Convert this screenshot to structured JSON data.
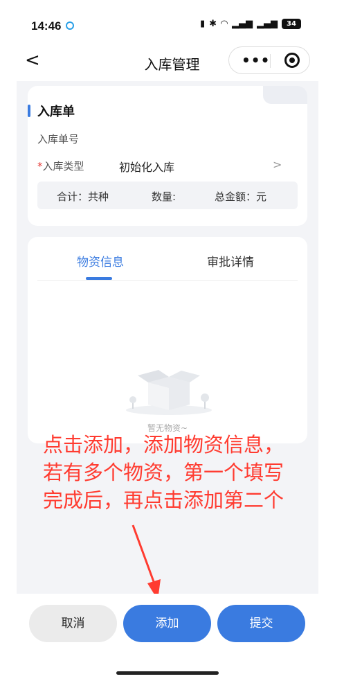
{
  "status_bar": {
    "time": "14:46",
    "battery": "34"
  },
  "nav": {
    "title": "入库管理"
  },
  "form": {
    "section_title": "入库单",
    "order_no_label": "入库单号",
    "type_required_mark": "*",
    "type_label": "入库类型",
    "type_value": "初始化入库",
    "chevron": ">",
    "summary": {
      "total": "合计：共种",
      "quantity": "数量:",
      "amount": "总金额：元"
    }
  },
  "tabs": [
    {
      "label": "物资信息",
      "active": true
    },
    {
      "label": "审批详情",
      "active": false
    }
  ],
  "empty_text": "暂无物资~",
  "annotation": [
    "点击添加，添加物资信息，",
    "若有多个物资，第一个填写",
    "完成后，再点击添加第二个"
  ],
  "buttons": {
    "cancel": "取消",
    "add": "添加",
    "submit": "提交"
  },
  "colors": {
    "accent": "#3a7be0",
    "annotation": "#ff3b30",
    "background": "#f3f4f7"
  }
}
